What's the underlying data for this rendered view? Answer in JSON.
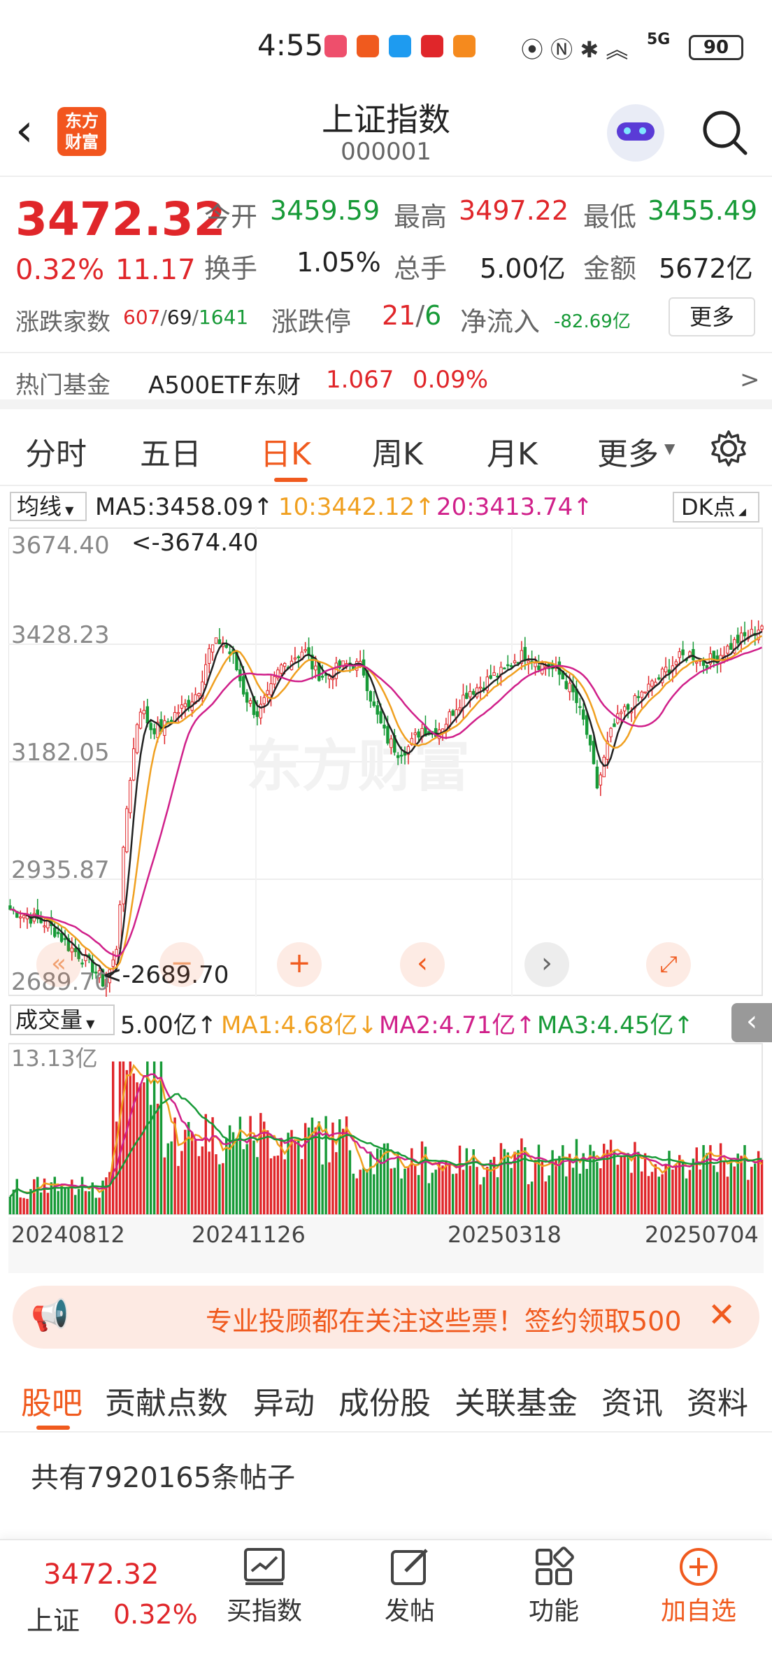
{
  "status_bar": {
    "time": "4:55",
    "network": "5G",
    "battery": "90"
  },
  "header": {
    "title": "上证指数",
    "code": "000001",
    "logo_text_1": "东方",
    "logo_text_2": "财富"
  },
  "quote": {
    "price": "3472.32",
    "change_pct": "0.32%",
    "change": "11.17",
    "open_label": "今开",
    "open": "3459.59",
    "high_label": "最高",
    "high": "3497.22",
    "low_label": "最低",
    "low": "3455.49",
    "turnover_label": "换手",
    "turnover": "1.05%",
    "volume_label": "总手",
    "volume": "5.00亿",
    "amount_label": "金额",
    "amount": "5672亿",
    "breadth_label": "涨跌家数",
    "breadth_up": "607",
    "breadth_flat": "69",
    "breadth_down": "1641",
    "limit_label": "涨跌停",
    "limit_up": "21",
    "limit_down": "6",
    "netflow_label": "净流入",
    "netflow": "-82.69亿",
    "more_button": "更多"
  },
  "hot_fund": {
    "label": "热门基金",
    "name": "A500ETF东财",
    "price": "1.067",
    "pct": "0.09%",
    "arrow": ">"
  },
  "period_tabs": [
    "分时",
    "五日",
    "日K",
    "周K",
    "月K",
    "更多"
  ],
  "active_period": "日K",
  "ma_bar": {
    "selector": "均线",
    "ma5": "MA5:3458.09",
    "ma10": "10:3442.12",
    "ma20": "20:3413.74",
    "dk_button": "DK点",
    "colors": {
      "ma5": "#222222",
      "ma10": "#f0a020",
      "ma20": "#d0208a"
    }
  },
  "price_axis": [
    "3674.40",
    "3428.23",
    "3182.05",
    "2935.87",
    "2689.70"
  ],
  "annotations": {
    "high": "<-3674.40",
    "low": "<-2689.70"
  },
  "watermark": "东方财富",
  "vol_bar": {
    "selector": "成交量",
    "value": "5.00亿",
    "ma1": "MA1:4.68亿",
    "ma2": "MA2:4.71亿",
    "ma3": "MA3:4.45亿",
    "max_label": "13.13亿"
  },
  "dates": [
    "20240812",
    "20241126",
    "20250318",
    "20250704"
  ],
  "banner": {
    "text": "专业投顾都在关注这些票！签约领取500"
  },
  "bottom_tabs": [
    "股吧",
    "贡献点数",
    "异动",
    "成份股",
    "关联基金",
    "资讯",
    "资料"
  ],
  "active_bottom_tab": "股吧",
  "posts_count": "共有7920165条帖子",
  "bottom_nav": {
    "index_price": "3472.32",
    "index_name": "上证",
    "index_pct": "0.32%",
    "items": [
      "买指数",
      "发帖",
      "功能",
      "加自选"
    ]
  },
  "chart_data": {
    "type": "candlestick",
    "y_range": [
      2689.7,
      3674.4
    ],
    "x_range": [
      "20240812",
      "20250704"
    ],
    "series_closes_approx": [
      2860,
      2850,
      2840,
      2830,
      2810,
      2780,
      2760,
      2735,
      2700,
      2760,
      3100,
      3300,
      3250,
      3250,
      3280,
      3300,
      3330,
      3420,
      3440,
      3400,
      3320,
      3280,
      3320,
      3380,
      3400,
      3420,
      3370,
      3360,
      3380,
      3390,
      3380,
      3290,
      3230,
      3200,
      3210,
      3250,
      3240,
      3260,
      3300,
      3330,
      3340,
      3360,
      3370,
      3400,
      3410,
      3390,
      3380,
      3360,
      3320,
      3250,
      3120,
      3230,
      3280,
      3300,
      3330,
      3350,
      3380,
      3400,
      3410,
      3390,
      3400,
      3420,
      3440,
      3450,
      3472
    ],
    "ma5": "3458.09",
    "ma10": "3442.12",
    "ma20": "3413.74"
  }
}
